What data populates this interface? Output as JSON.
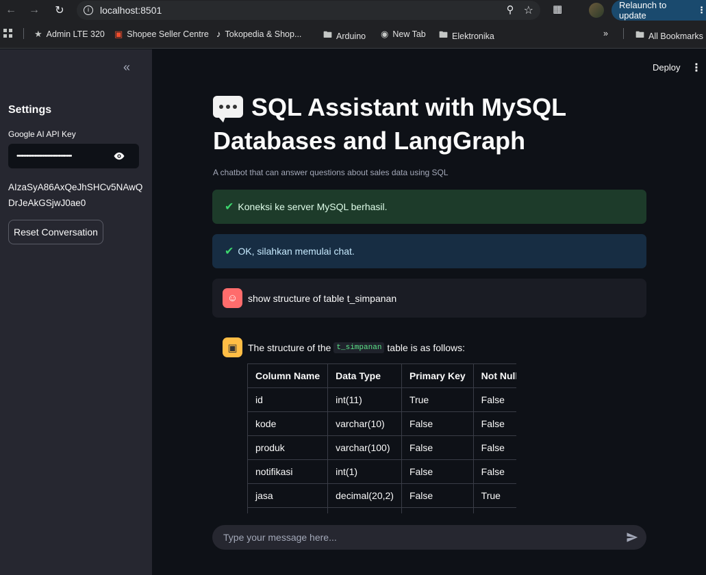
{
  "browser": {
    "url": "localhost:8501",
    "relaunch_label": "Relaunch to update",
    "bookmarks": [
      "Admin LTE 320",
      "Shopee Seller Centre",
      "Tokopedia & Shop...",
      "Arduino",
      "New Tab",
      "Elektronika"
    ],
    "all_bookmarks_label": "All Bookmarks"
  },
  "sidebar": {
    "title": "Settings",
    "api_key_label": "Google AI API Key",
    "api_key_masked": "••••••••••••••••••••••••••••••••••",
    "api_key_value": "AIzaSyA86AxQeJhSHCv5NAwQDrJeAkGSjwJ0ae0",
    "reset_label": "Reset Conversation"
  },
  "header": {
    "deploy_label": "Deploy"
  },
  "main": {
    "title": "SQL Assistant with MySQL Databases and LangGraph",
    "subtitle": "A chatbot that can answer questions about sales data using SQL",
    "alert_success": "Koneksi ke server MySQL berhasil.",
    "alert_info": "OK, silahkan memulai chat.",
    "user_message": "show structure of table t_simpanan",
    "bot_message_prefix": "The structure of the",
    "bot_message_code": "t_simpanan",
    "bot_message_suffix": "table is as follows:",
    "table": {
      "headers": [
        "Column Name",
        "Data Type",
        "Primary Key",
        "Not Null"
      ],
      "rows": [
        [
          "id",
          "int(11)",
          "True",
          "False"
        ],
        [
          "kode",
          "varchar(10)",
          "False",
          "False"
        ],
        [
          "produk",
          "varchar(100)",
          "False",
          "False"
        ],
        [
          "notifikasi",
          "int(1)",
          "False",
          "False"
        ],
        [
          "jasa",
          "decimal(20,2)",
          "False",
          "True"
        ]
      ]
    },
    "chat_placeholder": "Type your message here..."
  },
  "colors": {
    "success_bg": "#1d3b2a",
    "info_bg": "#172d43",
    "user_avatar": "#ff6c6c",
    "bot_avatar": "#ffbd45"
  }
}
